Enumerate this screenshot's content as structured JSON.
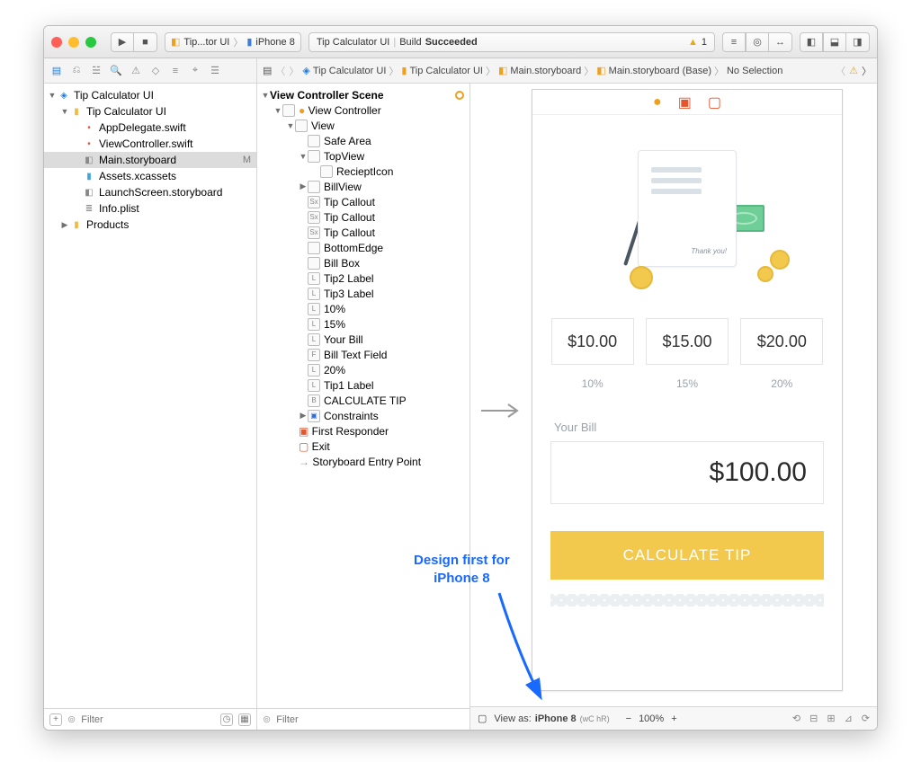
{
  "titlebar": {
    "scheme_target": "Tip...tor UI",
    "scheme_device": "iPhone 8",
    "status_project": "Tip Calculator UI",
    "status_sep": "|",
    "status_build": "Build",
    "status_result": "Succeeded",
    "warning_count": "1"
  },
  "breadcrumb": {
    "items": [
      "Tip Calculator UI",
      "Tip Calculator UI",
      "Main.storyboard",
      "Main.storyboard (Base)",
      "No Selection"
    ]
  },
  "navigator": {
    "project": "Tip Calculator UI",
    "group": "Tip Calculator UI",
    "files": [
      {
        "name": "AppDelegate.swift",
        "kind": "swift"
      },
      {
        "name": "ViewController.swift",
        "kind": "swift"
      },
      {
        "name": "Main.storyboard",
        "kind": "sb",
        "selected": true,
        "status": "M"
      },
      {
        "name": "Assets.xcassets",
        "kind": "assets"
      },
      {
        "name": "LaunchScreen.storyboard",
        "kind": "sb"
      },
      {
        "name": "Info.plist",
        "kind": "plist"
      }
    ],
    "products": "Products",
    "filter_placeholder": "Filter"
  },
  "outline": {
    "scene": "View Controller Scene",
    "vc": "View Controller",
    "view": "View",
    "safe_area": "Safe Area",
    "topview": "TopView",
    "receipt": "RecieptIcon",
    "billview": "BillView",
    "items": [
      {
        "g": "Sx",
        "t": "Tip Callout"
      },
      {
        "g": "Sx",
        "t": "Tip Callout"
      },
      {
        "g": "Sx",
        "t": "Tip Callout"
      },
      {
        "g": "",
        "t": "BottomEdge"
      },
      {
        "g": "",
        "t": "Bill Box"
      },
      {
        "g": "L",
        "t": "Tip2 Label"
      },
      {
        "g": "L",
        "t": "Tip3 Label"
      },
      {
        "g": "L",
        "t": "10%"
      },
      {
        "g": "L",
        "t": "15%"
      },
      {
        "g": "L",
        "t": "Your Bill"
      },
      {
        "g": "F",
        "t": "Bill Text Field"
      },
      {
        "g": "L",
        "t": "20%"
      },
      {
        "g": "L",
        "t": "Tip1 Label"
      },
      {
        "g": "B",
        "t": "CALCULATE TIP"
      }
    ],
    "constraints": "Constraints",
    "first_responder": "First Responder",
    "exit": "Exit",
    "entry": "Storyboard Entry Point",
    "filter_placeholder": "Filter"
  },
  "device": {
    "tips": [
      {
        "value": "$10.00",
        "pct": "10%"
      },
      {
        "value": "$15.00",
        "pct": "15%"
      },
      {
        "value": "$20.00",
        "pct": "20%"
      }
    ],
    "bill_label": "Your Bill",
    "bill_value": "$100.00",
    "calc_label": "CALCULATE TIP",
    "thanks": "Thank you!"
  },
  "canvas_footer": {
    "view_as_prefix": "View as:",
    "view_as_device": "iPhone 8",
    "size_class": "(wC hR)",
    "zoom": "100%"
  },
  "annotation": {
    "line1": "Design first for",
    "line2": "iPhone 8"
  }
}
